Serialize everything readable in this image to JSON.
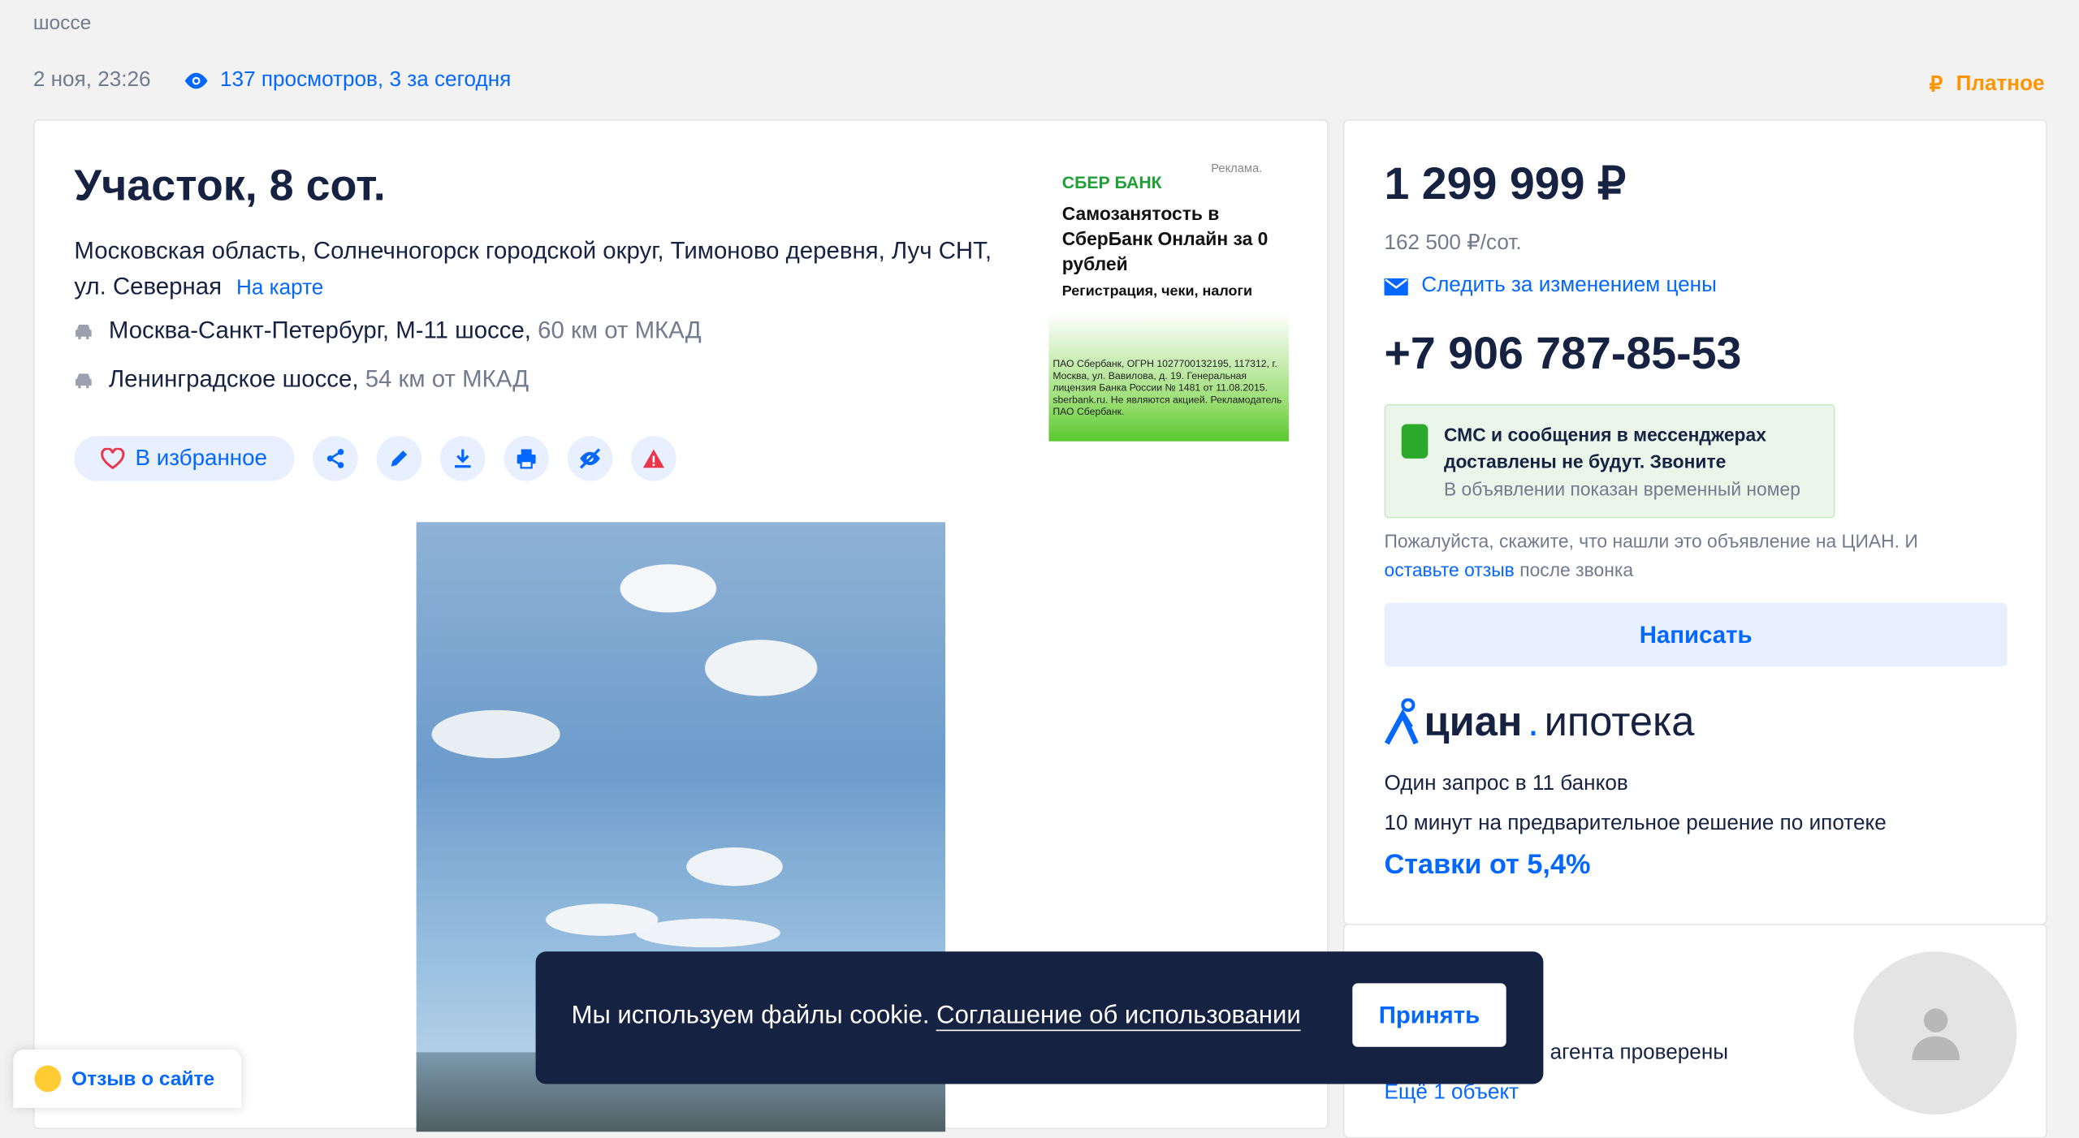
{
  "page": {
    "top_text": "шоссе",
    "date": "2 ноя, 23:26",
    "views": "137 просмотров, 3 за сегодня",
    "paid_label": "Платное",
    "paid_symbol": "₽"
  },
  "listing": {
    "title": "Участок, 8 сот.",
    "address": "Московская область, Солнечногорск городской округ, Тимоново деревня, Луч СНТ, ул. Северная",
    "map_link": "На карте",
    "roads": [
      {
        "name": "Москва-Санкт-Петербург, М-11 шоссе,",
        "distance": "60 км от МКАД"
      },
      {
        "name": "Ленинградское шоссе,",
        "distance": "54 км от МКАД"
      }
    ],
    "favorite_label": "В избранное"
  },
  "ad": {
    "tag": "Реклама.",
    "brand": "СБЕР БАНК",
    "headline": "Самозанятость в СберБанк Онлайн за 0 рублей",
    "subline": "Регистрация, чеки, налоги",
    "fine_print": "ПАО Сбербанк, ОГРН 1027700132195, 117312, г. Москва, ул. Вавилова, д. 19. Генеральная лицензия Банка России № 1481 от 11.08.2015. sberbank.ru. Не являются акцией. Рекламодатель ПАО Сбербанк."
  },
  "sidebar": {
    "price": "1 299 999 ₽",
    "price_per_unit": "162 500 ₽/сот.",
    "follow_price": "Следить за изменением цены",
    "phone": "+7 906 787-85-53",
    "notice_title": "СМС и сообщения в мессенджерах доставлены не будут. Звоните",
    "notice_sub": "В объявлении показан временный номер",
    "ask_prefix": "Пожалуйста, скажите, что нашли это объявление на ЦИАН. И",
    "ask_link": "оставьте отзыв",
    "ask_suffix": "после звонка",
    "write_button": "Написать",
    "logo_part1": "циан",
    "logo_dot": ".",
    "logo_part2": "ипотека",
    "line1": "Один запрос в 11 банков",
    "line2": "10 минут на предварительное решение по ипотеке",
    "rate": "Ставки от 5,4%",
    "agent_text": "агента проверены",
    "more_link": "Ещё 1 объект"
  },
  "cookie": {
    "text": "Мы используем файлы cookie.",
    "link": "Соглашение об использовании",
    "accept": "Принять"
  },
  "feedback": {
    "label": "Отзыв о сайте"
  },
  "colors": {
    "accent": "#0468ff",
    "text": "#152242",
    "muted": "#737a8e",
    "paid": "#ff9500",
    "cookie_bg": "#152242"
  }
}
